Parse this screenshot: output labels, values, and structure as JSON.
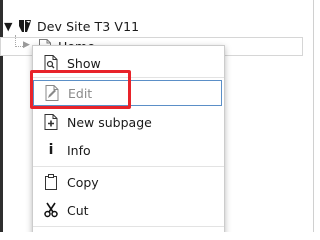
{
  "tree": {
    "root_toggle": "▼",
    "root_label": "Dev Site T3 V11",
    "home_toggle": "▶",
    "home_label": "Home"
  },
  "menu": {
    "items": [
      {
        "label": "Show",
        "icon": "document-view-icon"
      },
      {
        "label": "Edit",
        "icon": "document-edit-icon",
        "disabled": true,
        "focused": true
      },
      {
        "label": "New subpage",
        "icon": "new-page-icon"
      },
      {
        "label": "Info",
        "icon": "info-icon",
        "glyph": "i"
      },
      {
        "label": "Copy",
        "icon": "clipboard-icon"
      },
      {
        "label": "Cut",
        "icon": "scissors-icon"
      }
    ]
  },
  "colors": {
    "highlight": "#e8232a",
    "focus_border": "#5b8fc7",
    "typo3_orange": "#f49700"
  }
}
